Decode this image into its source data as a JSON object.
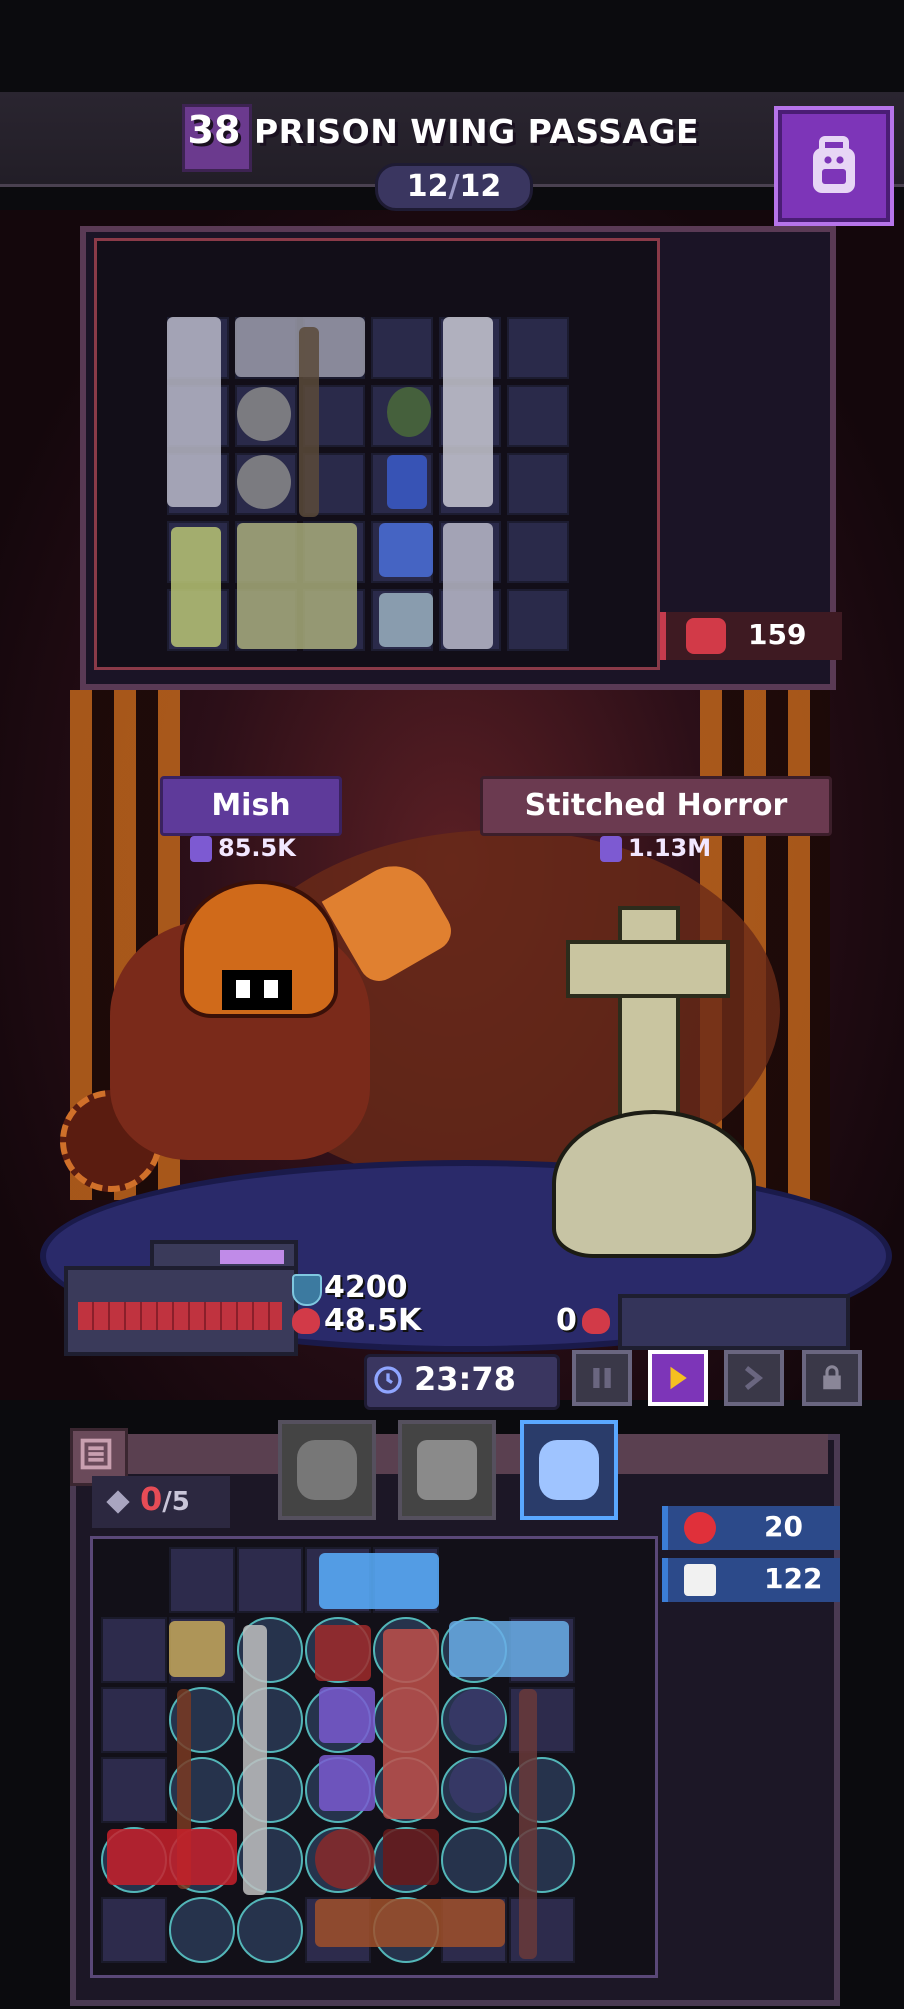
{
  "header": {
    "floor_number": "38",
    "level_title": "PRISON WING PASSAGE",
    "progress_current": "12",
    "progress_max": "12",
    "backpack_icon": "backpack-icon"
  },
  "enemy_inventory": {
    "hp_value": "159",
    "hp_icon": "blood-drop-icon"
  },
  "player": {
    "name": "Mish",
    "power": "85.5K",
    "shield": "4200",
    "health": "48.5K",
    "hp_fill_fraction": 1.0
  },
  "enemy": {
    "name": "Stitched Horror",
    "power": "1.13M",
    "health": "0"
  },
  "controls": {
    "timer": "23:78",
    "pause_icon": "pause-icon",
    "play_icon": "play-icon",
    "fast_forward_icon": "fast-forward-icon",
    "lock_icon": "lock-icon"
  },
  "bottom": {
    "slots_current": "0",
    "slots_max": "/5",
    "stat_attack_value": "20",
    "stat_crit_value": "122"
  },
  "colors": {
    "accent_purple": "#7d35b8",
    "health_red": "#c0333f",
    "shield_blue": "#3c7aa0",
    "grid_glow": "#64e0e0"
  }
}
